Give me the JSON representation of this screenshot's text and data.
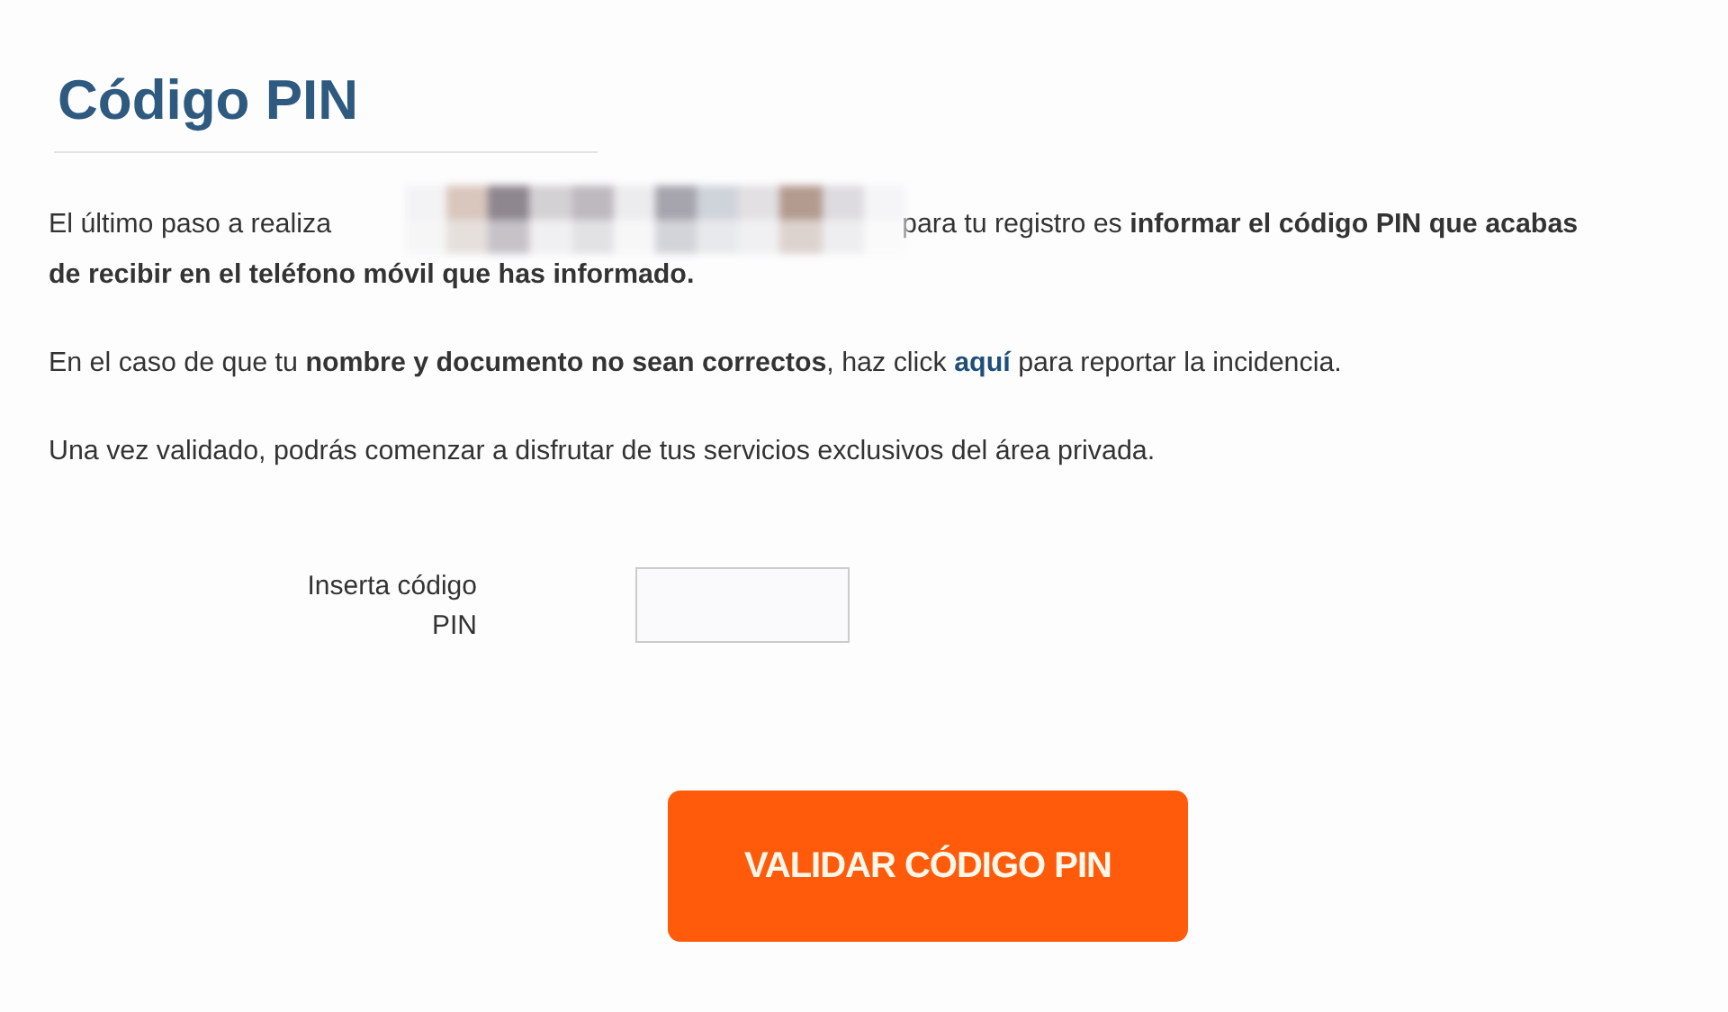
{
  "title": "Código PIN",
  "intro": {
    "before_redaction": "El último paso a realiza",
    "after_redaction": "para tu registro es **informar el código PIN que acabas**",
    "second_line": "de recibir en el teléfono móvil que has informado."
  },
  "report": {
    "before_link": "En el caso de que tu **nombre y documento no sean correctos**, haz click",
    "link": "aquí",
    "after_link": "para reportar la incidencia."
  },
  "closing": "Una vez validado, podrás comenzar a disfrutar de tus servicios exclusivos del área privada.",
  "pin_field": {
    "label": "Inserta código PIN"
  },
  "submit_button": "VALIDAR CÓDIGO PIN"
}
